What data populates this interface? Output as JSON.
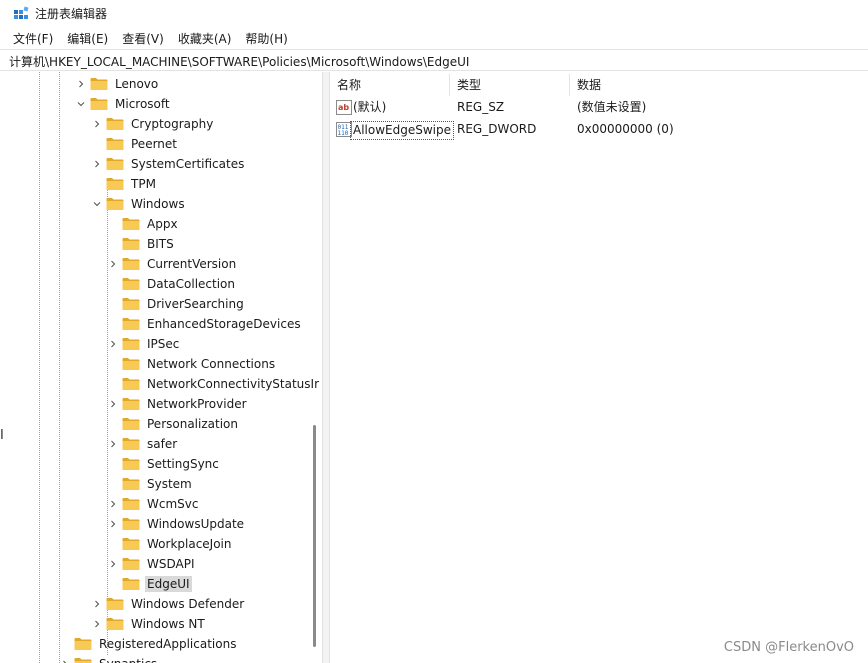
{
  "window": {
    "title": "注册表编辑器"
  },
  "menu": [
    "文件(F)",
    "编辑(E)",
    "查看(V)",
    "收藏夹(A)",
    "帮助(H)"
  ],
  "address": "计算机\\HKEY_LOCAL_MACHINE\\SOFTWARE\\Policies\\Microsoft\\Windows\\EdgeUI",
  "tree": [
    {
      "label": "Lenovo",
      "level": 0,
      "chevron": "right"
    },
    {
      "label": "Microsoft",
      "level": 0,
      "chevron": "down"
    },
    {
      "label": "Cryptography",
      "level": 1,
      "chevron": "right"
    },
    {
      "label": "Peernet",
      "level": 1,
      "chevron": "none"
    },
    {
      "label": "SystemCertificates",
      "level": 1,
      "chevron": "right"
    },
    {
      "label": "TPM",
      "level": 1,
      "chevron": "none"
    },
    {
      "label": "Windows",
      "level": 1,
      "chevron": "down"
    },
    {
      "label": "Appx",
      "level": 2,
      "chevron": "none"
    },
    {
      "label": "BITS",
      "level": 2,
      "chevron": "none"
    },
    {
      "label": "CurrentVersion",
      "level": 2,
      "chevron": "right"
    },
    {
      "label": "DataCollection",
      "level": 2,
      "chevron": "none"
    },
    {
      "label": "DriverSearching",
      "level": 2,
      "chevron": "none"
    },
    {
      "label": "EnhancedStorageDevices",
      "level": 2,
      "chevron": "none"
    },
    {
      "label": "IPSec",
      "level": 2,
      "chevron": "right"
    },
    {
      "label": "Network Connections",
      "level": 2,
      "chevron": "none"
    },
    {
      "label": "NetworkConnectivityStatusIr",
      "level": 2,
      "chevron": "none"
    },
    {
      "label": "NetworkProvider",
      "level": 2,
      "chevron": "right"
    },
    {
      "label": "Personalization",
      "level": 2,
      "chevron": "none"
    },
    {
      "label": "safer",
      "level": 2,
      "chevron": "right"
    },
    {
      "label": "SettingSync",
      "level": 2,
      "chevron": "none"
    },
    {
      "label": "System",
      "level": 2,
      "chevron": "none"
    },
    {
      "label": "WcmSvc",
      "level": 2,
      "chevron": "right"
    },
    {
      "label": "WindowsUpdate",
      "level": 2,
      "chevron": "right"
    },
    {
      "label": "WorkplaceJoin",
      "level": 2,
      "chevron": "none"
    },
    {
      "label": "WSDAPI",
      "level": 2,
      "chevron": "right"
    },
    {
      "label": "EdgeUI",
      "level": 2,
      "chevron": "none",
      "selected": true
    },
    {
      "label": "Windows Defender",
      "level": 1,
      "chevron": "right"
    },
    {
      "label": "Windows NT",
      "level": 1,
      "chevron": "right"
    },
    {
      "label": "RegisteredApplications",
      "level": -1,
      "chevron": "none"
    },
    {
      "label": "Synaptics",
      "level": -1,
      "chevron": "right"
    }
  ],
  "columns": {
    "name": "名称",
    "type": "类型",
    "data": "数据"
  },
  "values": [
    {
      "icon": "string-value-icon",
      "name": "(默认)",
      "type": "REG_SZ",
      "data": "(数值未设置)"
    },
    {
      "icon": "dword-value-icon",
      "name": "AllowEdgeSwipe",
      "type": "REG_DWORD",
      "data": "0x00000000 (0)"
    }
  ],
  "watermark": "CSDN @FlerkenOvO",
  "left_fragment": "I",
  "colors": {
    "folder": "#f8c955",
    "folder_dark": "#e0a92a",
    "selection": "#d9d9d9"
  }
}
